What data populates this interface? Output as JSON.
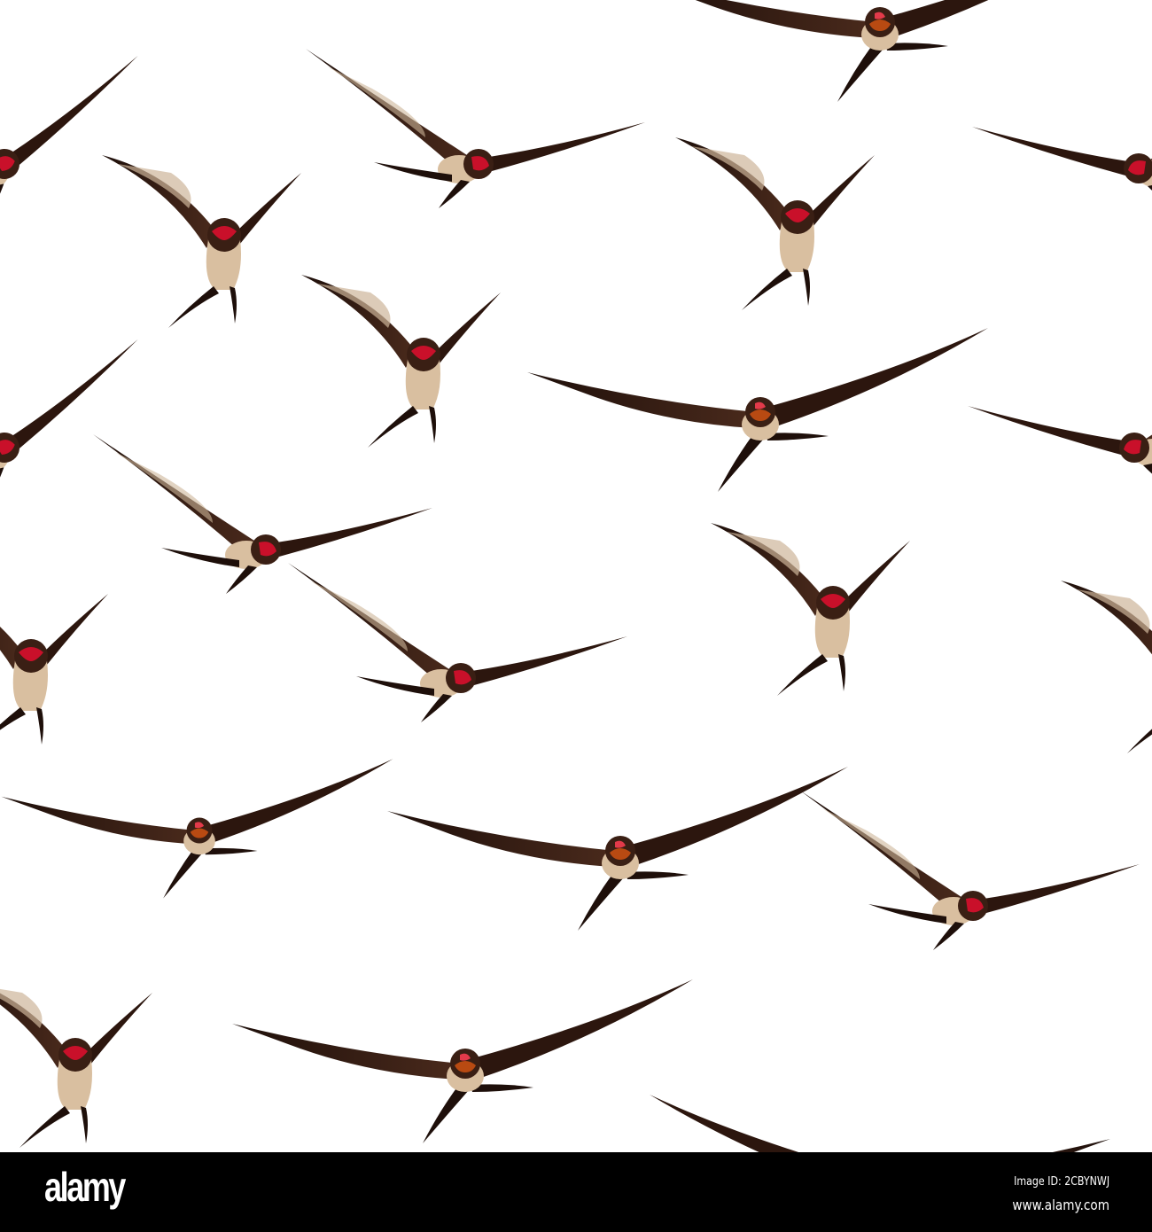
{
  "image": {
    "subject": "swallow-pattern",
    "bird_color": "#3a1f14",
    "throat_color": "#c9102a",
    "belly_color": "#d9bfa0"
  },
  "footer": {
    "logo": "alamy",
    "image_id": "Image ID: 2CBYNWJ",
    "website": "www.alamy.com"
  }
}
